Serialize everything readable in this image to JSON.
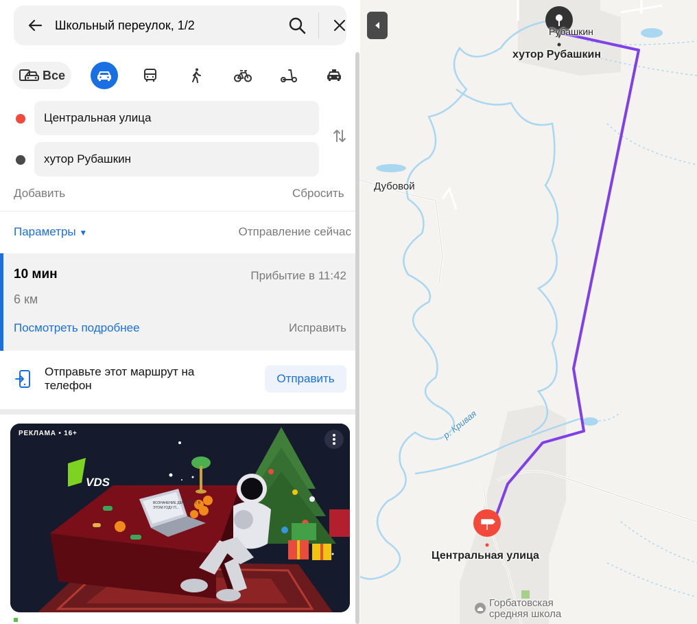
{
  "search": {
    "query": "Школьный переулок, 1/2"
  },
  "modes": {
    "all_label": "Все",
    "items": [
      "car-icon",
      "bus-icon",
      "walk-icon",
      "bicycle-icon",
      "scooter-icon",
      "taxi-icon"
    ],
    "active": "car-icon",
    "accent_color": "#1a6fe3"
  },
  "route_points": {
    "from": "Центральная улица",
    "to": "хутор Рубашкин",
    "from_color": "#f2493b",
    "to_color": "#4a4a4a"
  },
  "actions": {
    "add": "Добавить",
    "reset": "Сбросить"
  },
  "options": {
    "params": "Параметры",
    "departure": "Отправление сейчас"
  },
  "route": {
    "time": "10 мин",
    "arrival": "Прибытие в 11:42",
    "distance": "6 км",
    "details": "Посмотреть подробнее",
    "fix": "Исправить"
  },
  "send": {
    "text": "Отправьте этот маршрут на телефон",
    "button": "Отправить"
  },
  "ad": {
    "label": "РЕКЛАМА • 16+",
    "brand": "VDS",
    "laptop_text": "ВОЗНАЧЕНИЕ ДЕН ВОРОТ В ЭТОМ ГОДУ П..."
  },
  "map": {
    "labels": {
      "destination_small": "Рубашкин",
      "destination": "хутор Рубашкин",
      "village": "Дубовой",
      "river": "р. Кривая",
      "origin": "Центральная улица",
      "school": "Горбатовская средняя школа"
    },
    "route_color": "#8040e8"
  }
}
